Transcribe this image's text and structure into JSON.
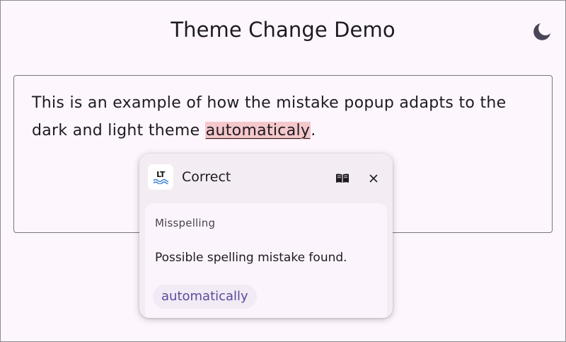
{
  "app_title": "Theme Change Demo",
  "theme_toggle_icon": "dark-mode-moon-icon",
  "editor": {
    "text_before": "This is an example of how the mistake popup adapts to the dark and light theme ",
    "mistake_word": "automaticaly",
    "text_after": "."
  },
  "popup": {
    "logo_text": "LT",
    "title": "Correct",
    "dictionary_icon": "book-icon",
    "close_icon": "close-icon",
    "category": "Misspelling",
    "message": "Possible spelling mistake found.",
    "suggestion": "automatically"
  },
  "colors": {
    "background": "#fdf6fd",
    "mistake_highlight": "#f5c8cb",
    "suggestion_text": "#5a4b9c",
    "logo_wave": "#3a7fd5"
  }
}
